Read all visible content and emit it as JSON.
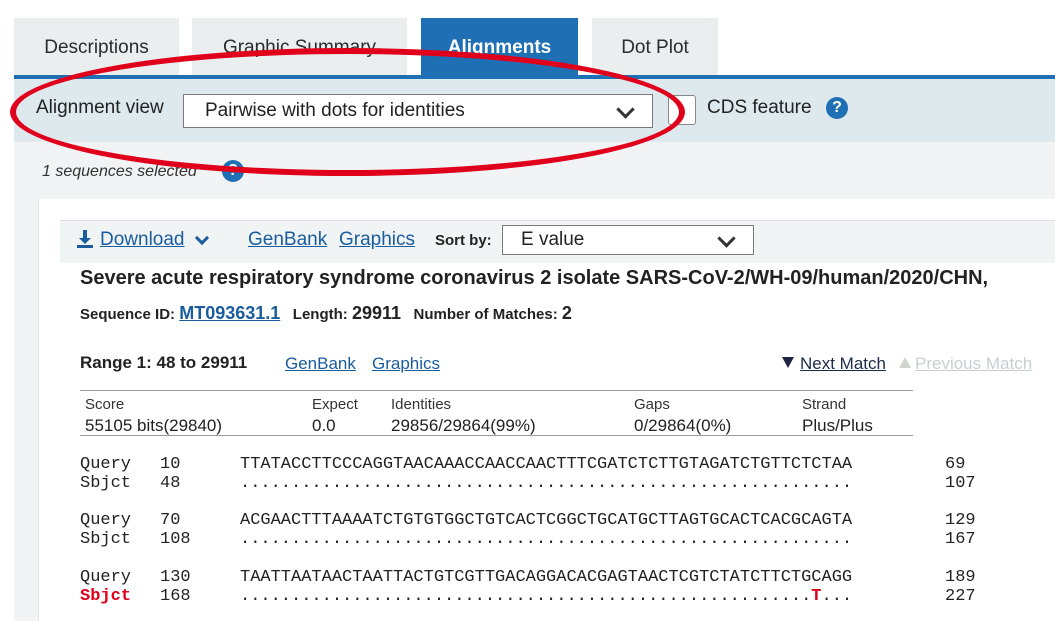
{
  "tabs": [
    {
      "label": "Descriptions",
      "active": false
    },
    {
      "label": "Graphic Summary",
      "active": false
    },
    {
      "label": "Alignments",
      "active": true
    },
    {
      "label": "Dot Plot",
      "active": false
    }
  ],
  "toolbar": {
    "alignment_view_label": "Alignment view",
    "alignment_view_value": "Pairwise with dots for identities",
    "cds_label": "CDS feature",
    "help": "?"
  },
  "selection": {
    "text": "1 sequences selected"
  },
  "subbar": {
    "download": "Download",
    "genbank": "GenBank",
    "graphics": "Graphics",
    "sort_label": "Sort by:",
    "sort_value": "E value"
  },
  "hit": {
    "title": "Severe acute respiratory syndrome coronavirus 2 isolate SARS-CoV-2/WH-09/human/2020/CHN,",
    "seq_id_label": "Sequence ID:",
    "seq_id": "MT093631.1",
    "length_label": "Length:",
    "length": "29911",
    "matches_label": "Number of Matches:",
    "matches": "2",
    "range_label": "Range 1: 48 to 29911",
    "range_genbank": "GenBank",
    "range_graphics": "Graphics",
    "next_match": "Next Match",
    "prev_match": "Previous Match"
  },
  "stats": {
    "headers": [
      "Score",
      "Expect",
      "Identities",
      "Gaps",
      "Strand"
    ],
    "values": [
      "55105 bits(29840)",
      "0.0",
      "29856/29864(99%)",
      "0/29864(0%)",
      "Plus/Plus"
    ]
  },
  "alignment": [
    {
      "q_label": "Query",
      "q_start": "10",
      "q_seq": "TTATACCTTCCCAGGTAACAAACCAACCAACTTTCGATCTCTTGTAGATCTGTTCTCTAA",
      "q_end": "69",
      "s_label": "Sbjct",
      "s_start": "48",
      "s_seq_pre": "............................................................",
      "s_mut": "",
      "s_seq_post": "",
      "s_end": "107"
    },
    {
      "q_label": "Query",
      "q_start": "70",
      "q_seq": "ACGAACTTTAAAATCTGTGTGGCTGTCACTCGGCTGCATGCTTAGTGCACTCACGCAGTA",
      "q_end": "129",
      "s_label": "Sbjct",
      "s_start": "108",
      "s_seq_pre": "............................................................",
      "s_mut": "",
      "s_seq_post": "",
      "s_end": "167"
    },
    {
      "q_label": "Query",
      "q_start": "130",
      "q_seq": "TAATTAATAACTAATTACTGTCGTTGACAGGACACGAGTAACTCGTCTATCTTCTGCAGG",
      "q_end": "189",
      "s_label": "Sbjct",
      "s_start": "168",
      "s_seq_pre": "........................................................",
      "s_mut": "T",
      "s_seq_post": "...",
      "s_end": "227"
    }
  ],
  "colors": {
    "accent": "#1f6fb4",
    "highlight": "#e0001b",
    "toolbar": "#dde9ec"
  }
}
